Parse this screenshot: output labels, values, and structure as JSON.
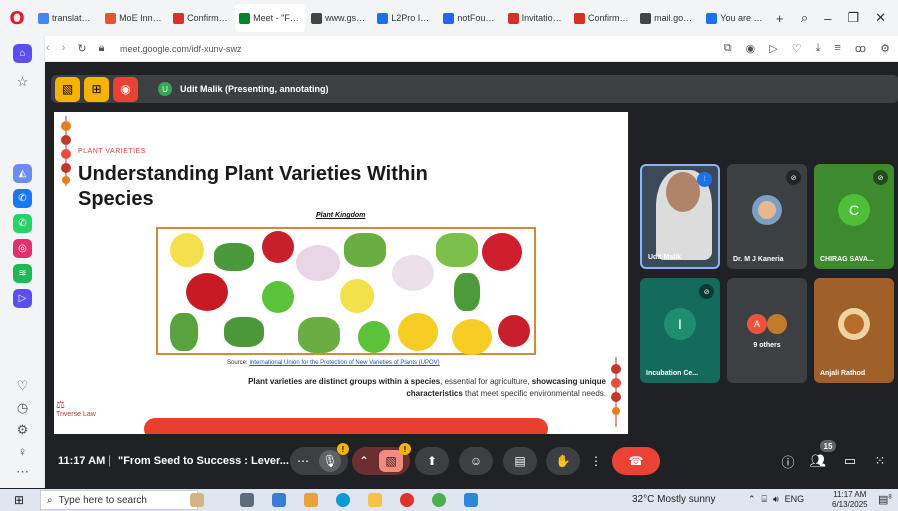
{
  "browser": {
    "tabs": [
      {
        "label": "translate.go",
        "icon_color": "#4285f4",
        "active": false
      },
      {
        "label": "MoE Innova",
        "icon_color": "#e45735",
        "active": false
      },
      {
        "label": "Confirmatio",
        "icon_color": "#d93025",
        "active": false
      },
      {
        "label": "Meet - \"From",
        "icon_color": "#00832d",
        "active": true
      },
      {
        "label": "www.gsebe",
        "icon_color": "#444444",
        "active": false
      },
      {
        "label": "L2Pro India",
        "icon_color": "#1a73e8",
        "active": false
      },
      {
        "label": "notFoundP",
        "icon_color": "#2962ff",
        "active": false
      },
      {
        "label": "Invitation: T",
        "icon_color": "#d93025",
        "active": false
      },
      {
        "label": "Confirmatio",
        "icon_color": "#d93025",
        "active": false
      },
      {
        "label": "mail.google",
        "icon_color": "#444444",
        "active": false
      },
      {
        "label": "You are sign",
        "icon_color": "#1a73e8",
        "active": false
      }
    ],
    "new_tab_label": "+",
    "url": "meet.google.com/idf-xunv-swz"
  },
  "presentation_bar": {
    "presenter_initial": "U",
    "presenter_label": "Udit Malik (Presenting, annotating)"
  },
  "slide": {
    "tag": "PLANT VARIETIES",
    "title": "Understanding Plant Varieties Within Species",
    "subtitle": "Plant Kingdom",
    "source_prefix": "Source: ",
    "source_link": "International Union for the Protection of New Varieties of Plants (UPOV)",
    "body_bold_1": "Plant varieties are distinct groups within a species",
    "body_text_1": ", essential for agriculture, ",
    "body_bold_2": "showcasing unique characteristics",
    "body_text_2": " that meet specific environmental needs.",
    "logo_text": "Triverse Law"
  },
  "participants": [
    {
      "name": "Udit Malik",
      "type": "video"
    },
    {
      "name": "Dr. M J Kaneria",
      "type": "photo"
    },
    {
      "name": "CHIRAG SAVA...",
      "type": "initial",
      "initial": "C",
      "color": "#34a853"
    },
    {
      "name": "Incubation Ce...",
      "type": "initial",
      "initial": "I",
      "color": "#1e8e6e"
    },
    {
      "name": "9 others",
      "type": "group",
      "initial": "A"
    },
    {
      "name": "Anjali Rathod",
      "type": "photo"
    }
  ],
  "controls": {
    "time": "11:17 AM",
    "separator": "|",
    "meeting_title": "\"From Seed to Success : Lever...",
    "mic_badge": "!",
    "camera_badge": "!",
    "people_count": "15"
  },
  "taskbar": {
    "search_placeholder": "Type here to search",
    "weather": "32°C  Mostly sunny",
    "lang": "ENG",
    "clock_time": "11:17 AM",
    "clock_date": "6/13/2025",
    "notif_count": "8"
  }
}
